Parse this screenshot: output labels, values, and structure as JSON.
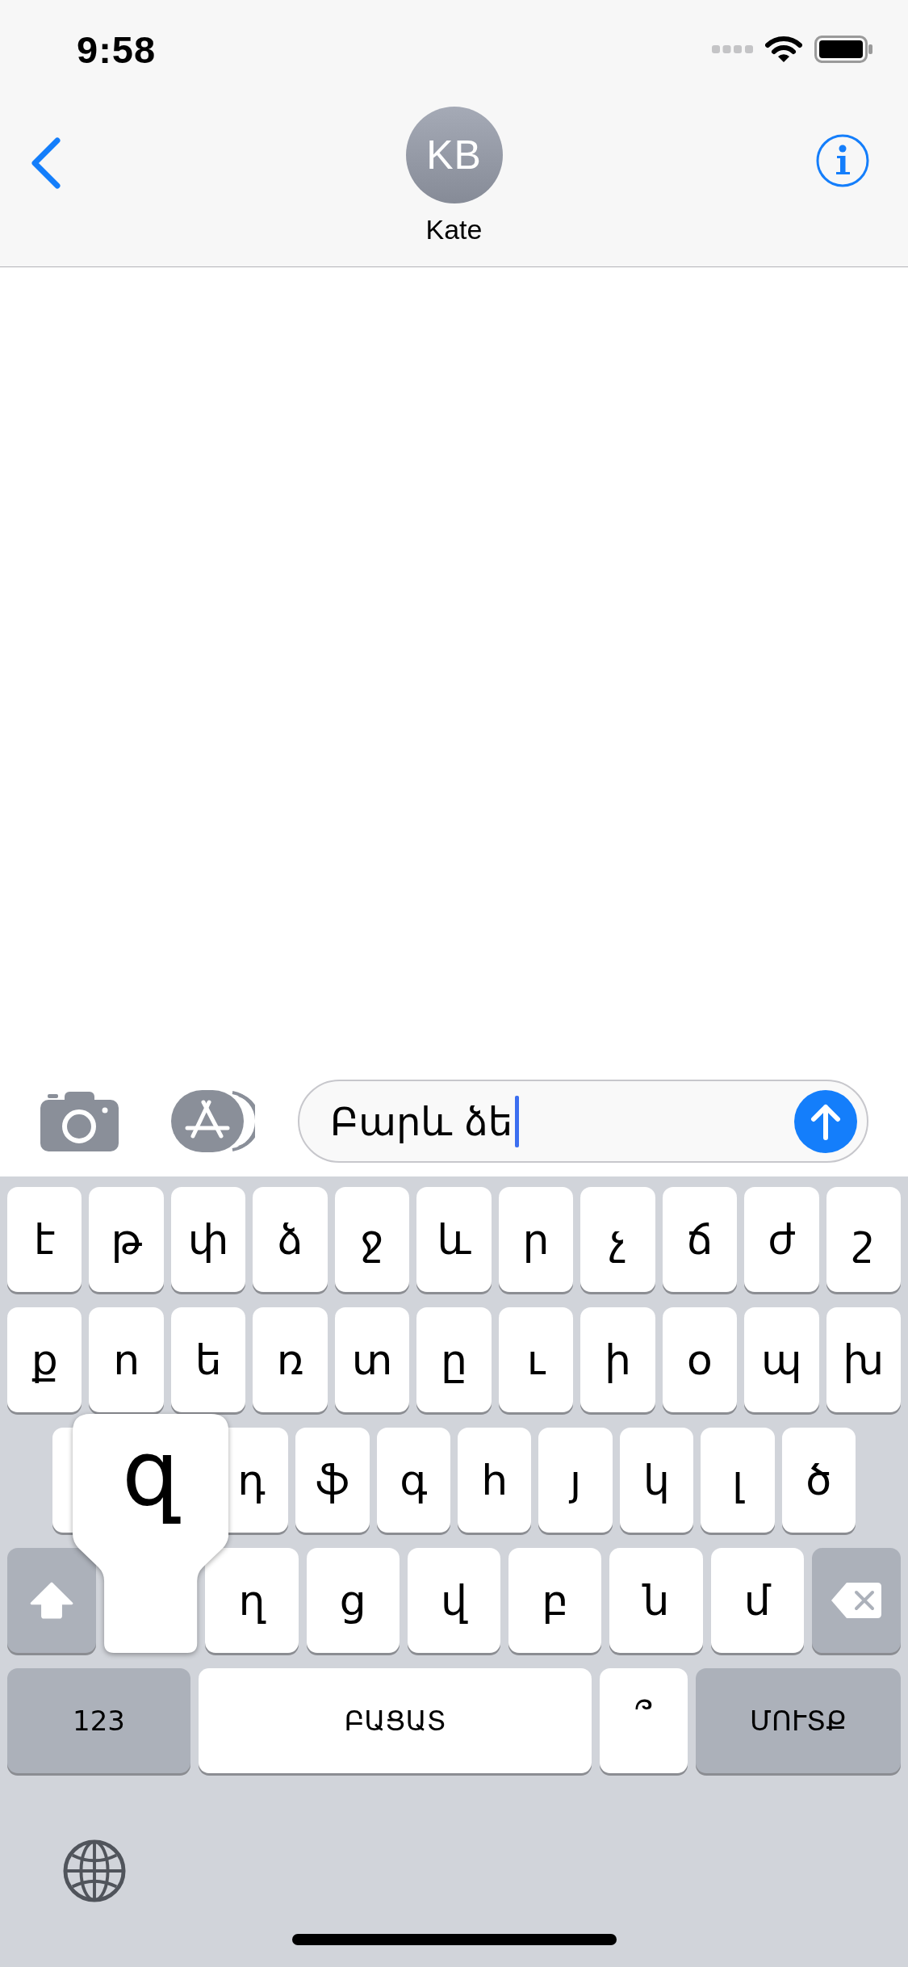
{
  "status_bar": {
    "time": "9:58"
  },
  "header": {
    "avatar_initials": "KB",
    "contact_name": "Kate"
  },
  "composer": {
    "value": "Բարև ձե"
  },
  "keyboard": {
    "rows": [
      {
        "keys": [
          {
            "kind": "letter",
            "label": "է"
          },
          {
            "kind": "letter",
            "label": "թ"
          },
          {
            "kind": "letter",
            "label": "փ"
          },
          {
            "kind": "letter",
            "label": "ձ"
          },
          {
            "kind": "letter",
            "label": "ջ"
          },
          {
            "kind": "letter",
            "label": "և"
          },
          {
            "kind": "letter",
            "label": "ր"
          },
          {
            "kind": "letter",
            "label": "չ"
          },
          {
            "kind": "letter",
            "label": "ճ"
          },
          {
            "kind": "letter",
            "label": "ժ"
          },
          {
            "kind": "letter",
            "label": "շ"
          }
        ]
      },
      {
        "keys": [
          {
            "kind": "letter",
            "label": "ք"
          },
          {
            "kind": "letter",
            "label": "ո"
          },
          {
            "kind": "letter",
            "label": "ե"
          },
          {
            "kind": "letter",
            "label": "ռ"
          },
          {
            "kind": "letter",
            "label": "տ"
          },
          {
            "kind": "letter",
            "label": "ը"
          },
          {
            "kind": "letter",
            "label": "ւ"
          },
          {
            "kind": "letter",
            "label": "ի"
          },
          {
            "kind": "letter",
            "label": "օ"
          },
          {
            "kind": "letter",
            "label": "պ"
          },
          {
            "kind": "letter",
            "label": "խ"
          }
        ]
      },
      {
        "keys": [
          {
            "kind": "covered"
          },
          {
            "kind": "hidden"
          },
          {
            "kind": "letter",
            "label": "դ"
          },
          {
            "kind": "letter",
            "label": "ֆ"
          },
          {
            "kind": "letter",
            "label": "գ"
          },
          {
            "kind": "letter",
            "label": "հ"
          },
          {
            "kind": "letter",
            "label": "յ"
          },
          {
            "kind": "letter",
            "label": "կ"
          },
          {
            "kind": "letter",
            "label": "լ"
          },
          {
            "kind": "letter",
            "label": "ծ"
          }
        ]
      },
      {
        "keys": [
          {
            "kind": "shift"
          },
          {
            "kind": "pressed",
            "label": "զ"
          },
          {
            "kind": "letter",
            "label": "ղ"
          },
          {
            "kind": "letter",
            "label": "ց"
          },
          {
            "kind": "letter",
            "label": "վ"
          },
          {
            "kind": "letter",
            "label": "բ"
          },
          {
            "kind": "letter",
            "label": "ն"
          },
          {
            "kind": "letter",
            "label": "մ"
          },
          {
            "kind": "delete"
          }
        ]
      },
      {
        "keys": [
          {
            "kind": "mode",
            "label": "123"
          },
          {
            "kind": "space",
            "label": "ԲԱՑԱՏ"
          },
          {
            "kind": "punct",
            "label": "՞"
          },
          {
            "kind": "return",
            "label": "ՄՈՒՏՔ"
          }
        ]
      }
    ]
  }
}
